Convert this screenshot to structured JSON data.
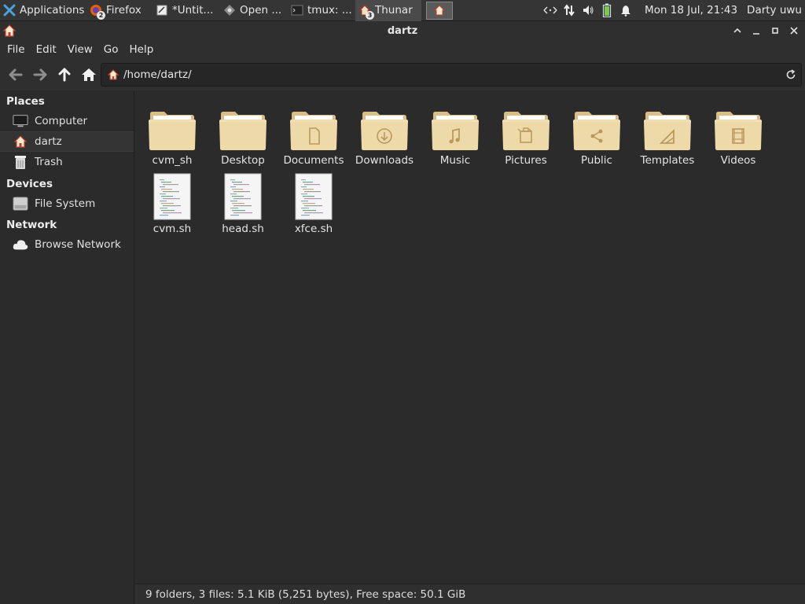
{
  "panel": {
    "tasks": [
      {
        "label": "Applications",
        "icon": "xfce-mouse-icon"
      },
      {
        "label": "Firefox",
        "icon": "firefox-icon",
        "badge": "2"
      },
      {
        "label": "*Untit...",
        "icon": "text-editor-icon"
      },
      {
        "label": "Open ...",
        "icon": "open-file-icon"
      },
      {
        "label": "tmux: ...",
        "icon": "terminal-icon"
      },
      {
        "label": "Thunar",
        "icon": "home-folder-icon",
        "badge": "3"
      }
    ],
    "clock": "Mon 18 Jul, 21:43",
    "user": "Darty uwu"
  },
  "window": {
    "title": "dartz"
  },
  "menu": [
    "File",
    "Edit",
    "View",
    "Go",
    "Help"
  ],
  "location": {
    "path": "/home/dartz/"
  },
  "sidebar": {
    "sections": [
      {
        "title": "Places",
        "items": [
          "Computer",
          "dartz",
          "Trash"
        ]
      },
      {
        "title": "Devices",
        "items": [
          "File System"
        ]
      },
      {
        "title": "Network",
        "items": [
          "Browse Network"
        ]
      }
    ]
  },
  "files": [
    {
      "name": "cvm_sh",
      "kind": "folder",
      "emblem": ""
    },
    {
      "name": "Desktop",
      "kind": "folder",
      "emblem": ""
    },
    {
      "name": "Documents",
      "kind": "folder",
      "emblem": "document"
    },
    {
      "name": "Downloads",
      "kind": "folder",
      "emblem": "download"
    },
    {
      "name": "Music",
      "kind": "folder",
      "emblem": "music"
    },
    {
      "name": "Pictures",
      "kind": "folder",
      "emblem": "picture"
    },
    {
      "name": "Public",
      "kind": "folder",
      "emblem": "share"
    },
    {
      "name": "Templates",
      "kind": "folder",
      "emblem": "template"
    },
    {
      "name": "Videos",
      "kind": "folder",
      "emblem": "video"
    },
    {
      "name": "cvm.sh",
      "kind": "script"
    },
    {
      "name": "head.sh",
      "kind": "script"
    },
    {
      "name": "xfce.sh",
      "kind": "script"
    }
  ],
  "status": {
    "text": "9 folders, 3 files: 5.1 KiB (5,251 bytes), Free space: 50.1 GiB"
  },
  "colors": {
    "folder": "#eed9a9",
    "folder_dark": "#d9bf86",
    "panel_bg": "#353535",
    "window_bg": "#2b2b2b"
  }
}
